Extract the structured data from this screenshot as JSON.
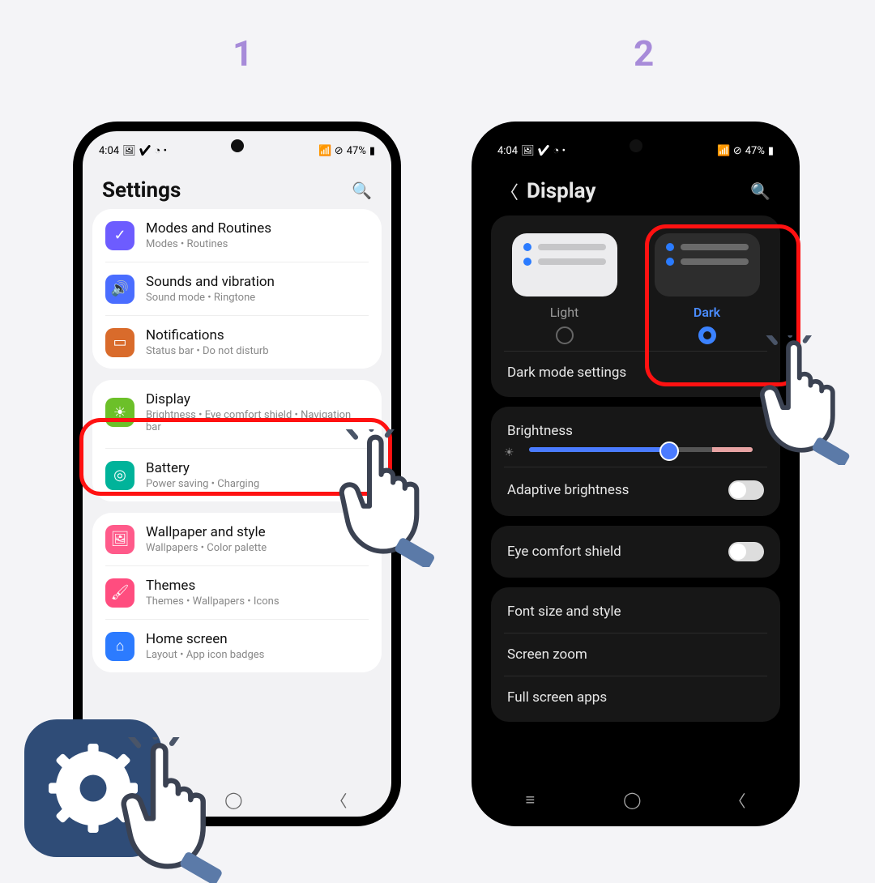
{
  "steps": {
    "one": "1",
    "two": "2"
  },
  "status": {
    "time": "4:04",
    "battery": "47%",
    "icons": "🖼 ✔ ◔ •",
    "right": "📶 ⊘"
  },
  "settings": {
    "title": "Settings",
    "items": [
      {
        "title": "Modes and Routines",
        "sub": "Modes  •  Routines",
        "color": "#6d5cff",
        "glyph": "✔"
      },
      {
        "title": "Sounds and vibration",
        "sub": "Sound mode  •  Ringtone",
        "color": "#4a6dff",
        "glyph": "🔊"
      },
      {
        "title": "Notifications",
        "sub": "Status bar  •  Do not disturb",
        "color": "#d96b2b",
        "glyph": "▭"
      },
      {
        "title": "Display",
        "sub": "Brightness  •  Eye comfort shield  •  Navigation bar",
        "color": "#6cc029",
        "glyph": "☀"
      },
      {
        "title": "Battery",
        "sub": "Power saving  •  Charging",
        "color": "#00b39a",
        "glyph": "◎"
      },
      {
        "title": "Wallpaper and style",
        "sub": "Wallpapers  •  Color palette",
        "color": "#ff5a8a",
        "glyph": "🖼"
      },
      {
        "title": "Themes",
        "sub": "Themes  •  Wallpapers  •  Icons",
        "color": "#ff4d7f",
        "glyph": "🖌"
      },
      {
        "title": "Home screen",
        "sub": "Layout  •  App icon badges",
        "color": "#2c7bff",
        "glyph": "⌂"
      }
    ]
  },
  "display": {
    "title": "Display",
    "light": "Light",
    "dark": "Dark",
    "dark_mode_settings": "Dark mode settings",
    "brightness": "Brightness",
    "brightness_pct": 62,
    "adaptive": "Adaptive brightness",
    "eye": "Eye comfort shield",
    "font": "Font size and style",
    "zoom": "Screen zoom",
    "full": "Full screen apps"
  }
}
